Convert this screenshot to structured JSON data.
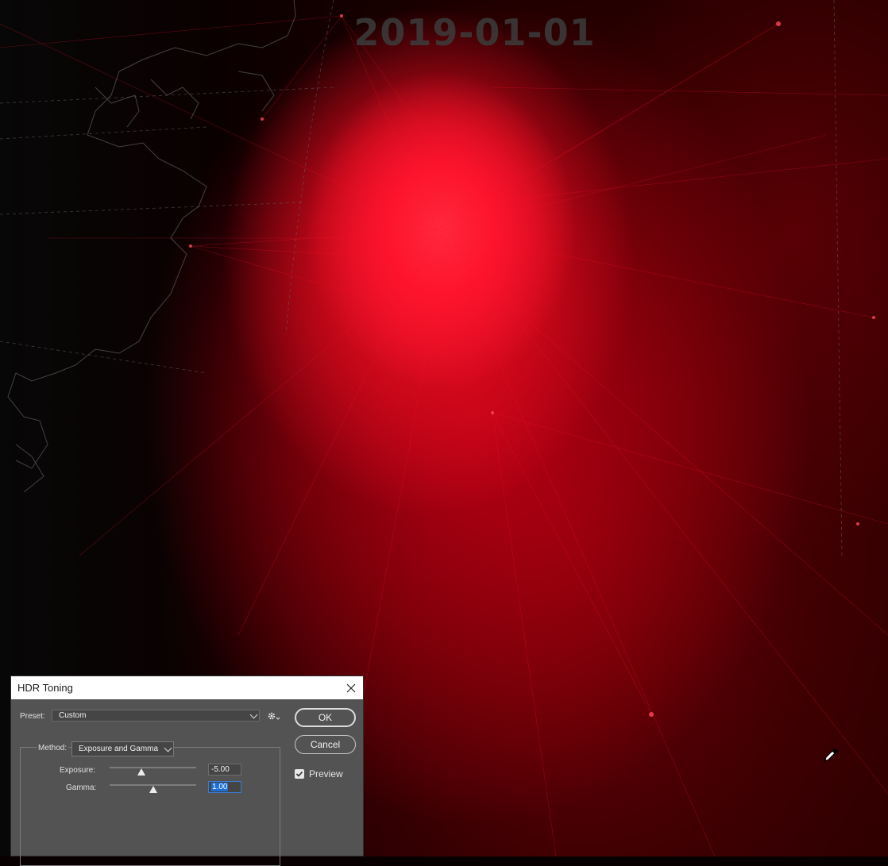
{
  "canvas": {
    "date_stamp": "2019-01-01"
  },
  "dialog": {
    "title": "HDR Toning",
    "preset_label": "Preset:",
    "preset_value": "Custom",
    "ok_label": "OK",
    "cancel_label": "Cancel",
    "preview_label": "Preview",
    "preview_checked": true,
    "method_label": "Method:",
    "method_value": "Exposure and Gamma",
    "exposure_label": "Exposure:",
    "exposure_value": "-5.00",
    "exposure_slider_fraction": 0.37,
    "gamma_label": "Gamma:",
    "gamma_value": "1.00",
    "gamma_slider_fraction": 0.5
  },
  "icons": {
    "close": "close-icon",
    "gear": "gear-icon",
    "eyedropper": "eyedropper-icon",
    "checkbox": "checkmark-icon"
  },
  "colors": {
    "accent": "#1c6fd8",
    "dialog_bg": "#535353",
    "glow": "#ff1a3a"
  }
}
